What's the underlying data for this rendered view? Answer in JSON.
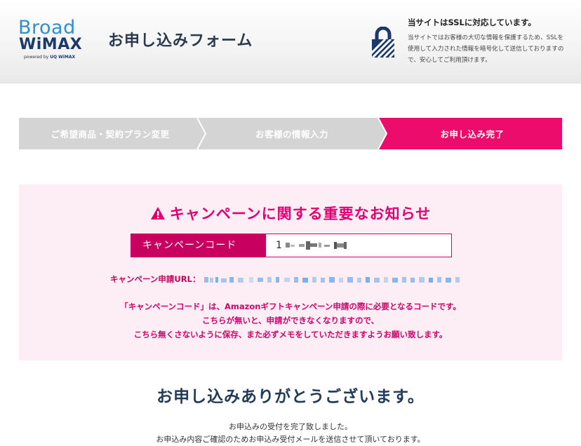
{
  "header": {
    "logo": {
      "line1": "Broad",
      "line2": "WiMAX",
      "powered_prefix": "powered by",
      "powered_brand": "UQ WiMAX"
    },
    "title": "お申し込みフォーム",
    "ssl": {
      "title": "当サイトはSSLに対応しています。",
      "description": "当サイトではお客様の大切な情報を保護するため、SSLを使用して入力された情報を暗号化して送信しておりますので、安心してご利用頂けます。"
    }
  },
  "steps": [
    {
      "label": "ご希望商品・契約プラン変更",
      "active": false
    },
    {
      "label": "お客様の情報入力",
      "active": false
    },
    {
      "label": "お申し込み完了",
      "active": true
    }
  ],
  "notice": {
    "title": "キャンペーンに関する重要なお知らせ",
    "code_label": "キャンペーンコード",
    "code_value_prefix": "1",
    "url_label": "キャンペーン申請URL：",
    "text_lines": [
      "「キャンペーンコード」は、Amazonギフトキャンペーン申請の際に必要となるコードです。",
      "こちらが無いと、申請ができなくなりますので、",
      "こちら無くさないように保存、また必ずメモをしていただきますようお願い致します。"
    ]
  },
  "thanks": {
    "title": "お申し込みありがとうございます。",
    "line1": "お申込みの受付を完了致しました。",
    "line2": "お申込み内容ご確認のためお申込み受付メールを送信させて頂いております。"
  },
  "colors": {
    "accent": "#ec0c6b",
    "notice_bg": "#fdeef5",
    "inactive_step": "#d4d4d4",
    "heading": "#233b5a"
  },
  "icons": {
    "lock": "lock-icon",
    "warning": "warning-icon"
  }
}
